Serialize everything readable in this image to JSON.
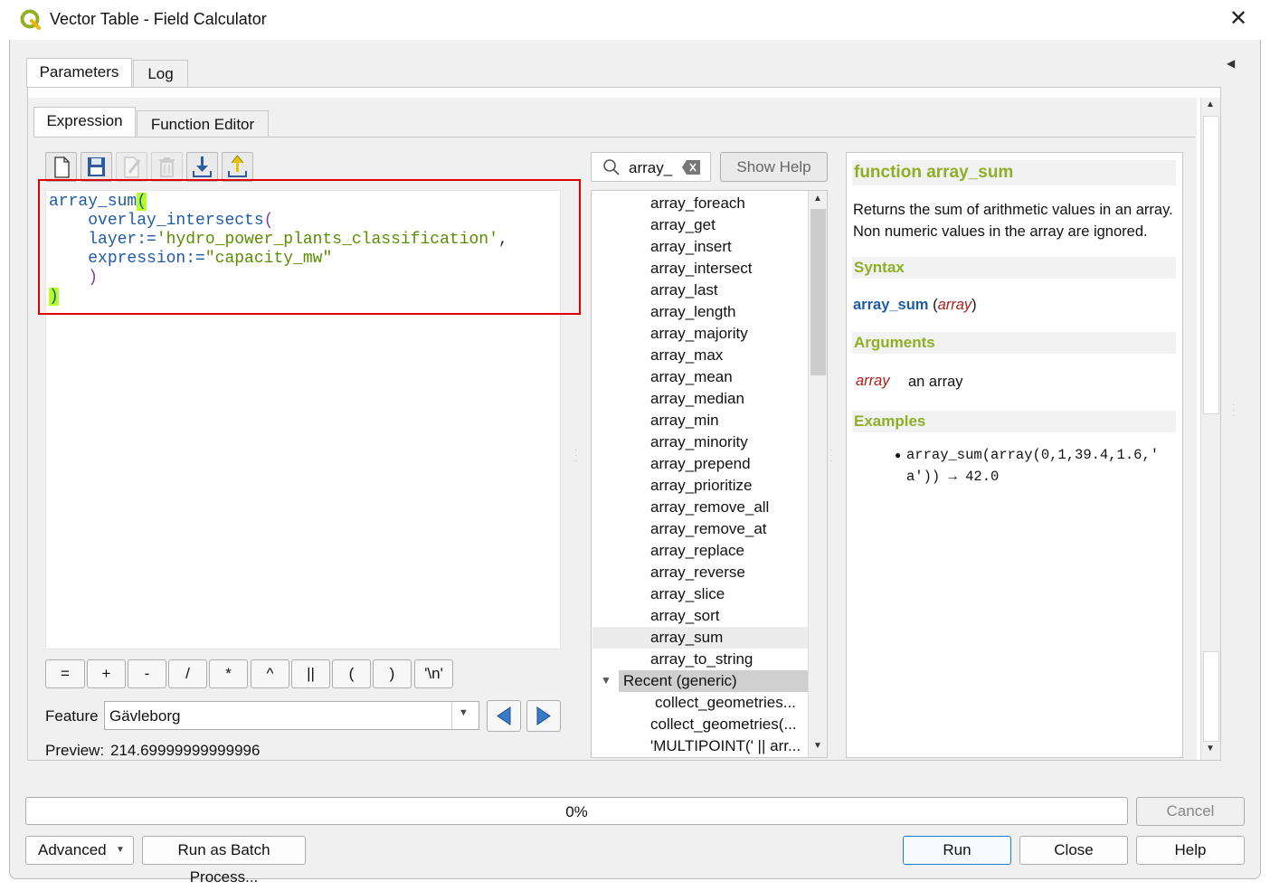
{
  "window": {
    "title": "Vector Table - Field Calculator",
    "outer_tabs": [
      "Parameters",
      "Log"
    ],
    "inner_tabs": [
      "Expression",
      "Function Editor"
    ]
  },
  "toolbar": {
    "icons": [
      "new-file-icon",
      "save-icon",
      "edit-icon",
      "delete-icon",
      "import-icon",
      "export-icon"
    ]
  },
  "expression": {
    "lines": [
      {
        "fn": "array_sum",
        "paren": "("
      },
      {
        "fn": "overlay_intersects",
        "paren": "("
      },
      {
        "param": "layer:=",
        "value": "'hydro_power_plants_classification'",
        "tail": ","
      },
      {
        "param": "expression:=",
        "value": "\"capacity_mw\""
      },
      {
        "paren": ")"
      },
      {
        "paren": ")"
      }
    ]
  },
  "operators": [
    "=",
    "+",
    "-",
    "/",
    "*",
    "^",
    "||",
    "(",
    ")",
    "'\\n'"
  ],
  "feature": {
    "label": "Feature",
    "value": "Gävleborg"
  },
  "preview": {
    "label": "Preview:",
    "value": "214.69999999999996"
  },
  "search": {
    "value": "array_",
    "show_help_label": "Show Help"
  },
  "function_list": {
    "items": [
      "array_foreach",
      "array_get",
      "array_insert",
      "array_intersect",
      "array_last",
      "array_length",
      "array_majority",
      "array_max",
      "array_mean",
      "array_median",
      "array_min",
      "array_minority",
      "array_prepend",
      "array_prioritize",
      "array_remove_all",
      "array_remove_at",
      "array_replace",
      "array_reverse",
      "array_slice",
      "array_sort",
      "array_sum",
      "array_to_string"
    ],
    "selected": "array_sum",
    "group_label": "Recent (generic)",
    "recent_items": [
      "collect_geometries...",
      "collect_geometries(...",
      "'MULTIPOINT(' || arr..."
    ]
  },
  "help": {
    "title": "function array_sum",
    "description_1": "Returns the sum of arithmetic values in an array.",
    "description_2": "Non numeric values in the array are ignored.",
    "syntax_header": "Syntax",
    "syntax_fn": "array_sum",
    "syntax_open": "(",
    "syntax_arg": "array",
    "syntax_close": ")",
    "arguments_header": "Arguments",
    "arg_name": "array",
    "arg_desc": "an array",
    "examples_header": "Examples",
    "example_line_1": "array_sum(array(0,1,39.4,1.6,'",
    "example_line_2": "a')) → 42.0"
  },
  "progress": {
    "percent": 0,
    "text": "0%"
  },
  "buttons": {
    "cancel": "Cancel",
    "advanced": "Advanced",
    "batch": "Run as Batch Process...",
    "run": "Run",
    "close": "Close",
    "help": "Help"
  },
  "colors": {
    "accent_green": "#8eaf25",
    "function_blue": "#1f5aa7",
    "string_green": "#5a8d00",
    "param_purple": "#8b3aa3",
    "highlight": "#b5ff27"
  }
}
